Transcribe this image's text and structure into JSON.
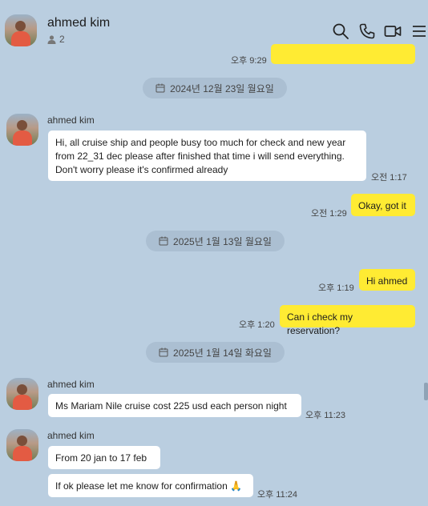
{
  "header": {
    "contact_name": "ahmed kim",
    "member_count": "2",
    "icons": [
      "search-icon",
      "phone-icon",
      "video-call-icon",
      "menu-icon"
    ]
  },
  "messages": {
    "top_time": "오후 9:29",
    "date1": "2024년 12월 23일 월요일",
    "m1_name": "ahmed kim",
    "m1_text": "Hi, all cruise ship and people busy too much for check and new year from 22_31 dec please after finished that time i will send everything. Don't worry please it's confirmed already",
    "m1_time": "오전 1:17",
    "m2_text": "Okay, got it",
    "m2_time": "오전 1:29",
    "date2": "2025년 1월 13일 월요일",
    "m3_text": "Hi ahmed",
    "m3_time": "오후 1:19",
    "m4_text": "Can i check my reservation?",
    "m4_time": "오후 1:20",
    "date3": "2025년 1월 14일 화요일",
    "m5_name": "ahmed kim",
    "m5_text": "Ms Mariam Nile cruise cost 225 usd each person night",
    "m5_time": "오후 11:23",
    "m6_name": "ahmed kim",
    "m6_text": "From 20 jan to 17 feb",
    "m7_text": "If ok please let me know for confirmation 🙏",
    "m7_time": "오후 11:24"
  },
  "colors": {
    "background": "#bacee0",
    "my_bubble": "#ffeb33",
    "their_bubble": "#ffffff"
  }
}
